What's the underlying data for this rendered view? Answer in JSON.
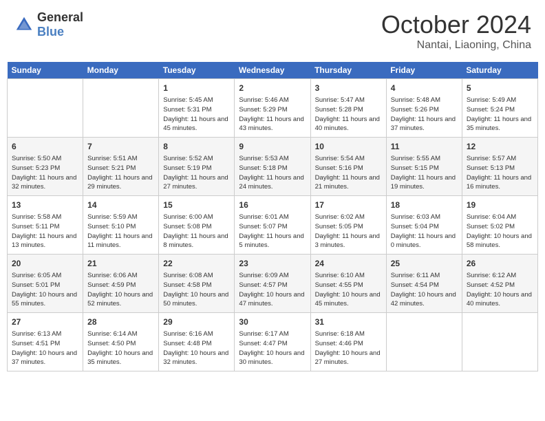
{
  "header": {
    "logo_general": "General",
    "logo_blue": "Blue",
    "month": "October 2024",
    "location": "Nantai, Liaoning, China"
  },
  "weekdays": [
    "Sunday",
    "Monday",
    "Tuesday",
    "Wednesday",
    "Thursday",
    "Friday",
    "Saturday"
  ],
  "weeks": [
    [
      {
        "day": "",
        "info": ""
      },
      {
        "day": "",
        "info": ""
      },
      {
        "day": "1",
        "info": "Sunrise: 5:45 AM\nSunset: 5:31 PM\nDaylight: 11 hours and 45 minutes."
      },
      {
        "day": "2",
        "info": "Sunrise: 5:46 AM\nSunset: 5:29 PM\nDaylight: 11 hours and 43 minutes."
      },
      {
        "day": "3",
        "info": "Sunrise: 5:47 AM\nSunset: 5:28 PM\nDaylight: 11 hours and 40 minutes."
      },
      {
        "day": "4",
        "info": "Sunrise: 5:48 AM\nSunset: 5:26 PM\nDaylight: 11 hours and 37 minutes."
      },
      {
        "day": "5",
        "info": "Sunrise: 5:49 AM\nSunset: 5:24 PM\nDaylight: 11 hours and 35 minutes."
      }
    ],
    [
      {
        "day": "6",
        "info": "Sunrise: 5:50 AM\nSunset: 5:23 PM\nDaylight: 11 hours and 32 minutes."
      },
      {
        "day": "7",
        "info": "Sunrise: 5:51 AM\nSunset: 5:21 PM\nDaylight: 11 hours and 29 minutes."
      },
      {
        "day": "8",
        "info": "Sunrise: 5:52 AM\nSunset: 5:19 PM\nDaylight: 11 hours and 27 minutes."
      },
      {
        "day": "9",
        "info": "Sunrise: 5:53 AM\nSunset: 5:18 PM\nDaylight: 11 hours and 24 minutes."
      },
      {
        "day": "10",
        "info": "Sunrise: 5:54 AM\nSunset: 5:16 PM\nDaylight: 11 hours and 21 minutes."
      },
      {
        "day": "11",
        "info": "Sunrise: 5:55 AM\nSunset: 5:15 PM\nDaylight: 11 hours and 19 minutes."
      },
      {
        "day": "12",
        "info": "Sunrise: 5:57 AM\nSunset: 5:13 PM\nDaylight: 11 hours and 16 minutes."
      }
    ],
    [
      {
        "day": "13",
        "info": "Sunrise: 5:58 AM\nSunset: 5:11 PM\nDaylight: 11 hours and 13 minutes."
      },
      {
        "day": "14",
        "info": "Sunrise: 5:59 AM\nSunset: 5:10 PM\nDaylight: 11 hours and 11 minutes."
      },
      {
        "day": "15",
        "info": "Sunrise: 6:00 AM\nSunset: 5:08 PM\nDaylight: 11 hours and 8 minutes."
      },
      {
        "day": "16",
        "info": "Sunrise: 6:01 AM\nSunset: 5:07 PM\nDaylight: 11 hours and 5 minutes."
      },
      {
        "day": "17",
        "info": "Sunrise: 6:02 AM\nSunset: 5:05 PM\nDaylight: 11 hours and 3 minutes."
      },
      {
        "day": "18",
        "info": "Sunrise: 6:03 AM\nSunset: 5:04 PM\nDaylight: 11 hours and 0 minutes."
      },
      {
        "day": "19",
        "info": "Sunrise: 6:04 AM\nSunset: 5:02 PM\nDaylight: 10 hours and 58 minutes."
      }
    ],
    [
      {
        "day": "20",
        "info": "Sunrise: 6:05 AM\nSunset: 5:01 PM\nDaylight: 10 hours and 55 minutes."
      },
      {
        "day": "21",
        "info": "Sunrise: 6:06 AM\nSunset: 4:59 PM\nDaylight: 10 hours and 52 minutes."
      },
      {
        "day": "22",
        "info": "Sunrise: 6:08 AM\nSunset: 4:58 PM\nDaylight: 10 hours and 50 minutes."
      },
      {
        "day": "23",
        "info": "Sunrise: 6:09 AM\nSunset: 4:57 PM\nDaylight: 10 hours and 47 minutes."
      },
      {
        "day": "24",
        "info": "Sunrise: 6:10 AM\nSunset: 4:55 PM\nDaylight: 10 hours and 45 minutes."
      },
      {
        "day": "25",
        "info": "Sunrise: 6:11 AM\nSunset: 4:54 PM\nDaylight: 10 hours and 42 minutes."
      },
      {
        "day": "26",
        "info": "Sunrise: 6:12 AM\nSunset: 4:52 PM\nDaylight: 10 hours and 40 minutes."
      }
    ],
    [
      {
        "day": "27",
        "info": "Sunrise: 6:13 AM\nSunset: 4:51 PM\nDaylight: 10 hours and 37 minutes."
      },
      {
        "day": "28",
        "info": "Sunrise: 6:14 AM\nSunset: 4:50 PM\nDaylight: 10 hours and 35 minutes."
      },
      {
        "day": "29",
        "info": "Sunrise: 6:16 AM\nSunset: 4:48 PM\nDaylight: 10 hours and 32 minutes."
      },
      {
        "day": "30",
        "info": "Sunrise: 6:17 AM\nSunset: 4:47 PM\nDaylight: 10 hours and 30 minutes."
      },
      {
        "day": "31",
        "info": "Sunrise: 6:18 AM\nSunset: 4:46 PM\nDaylight: 10 hours and 27 minutes."
      },
      {
        "day": "",
        "info": ""
      },
      {
        "day": "",
        "info": ""
      }
    ]
  ]
}
